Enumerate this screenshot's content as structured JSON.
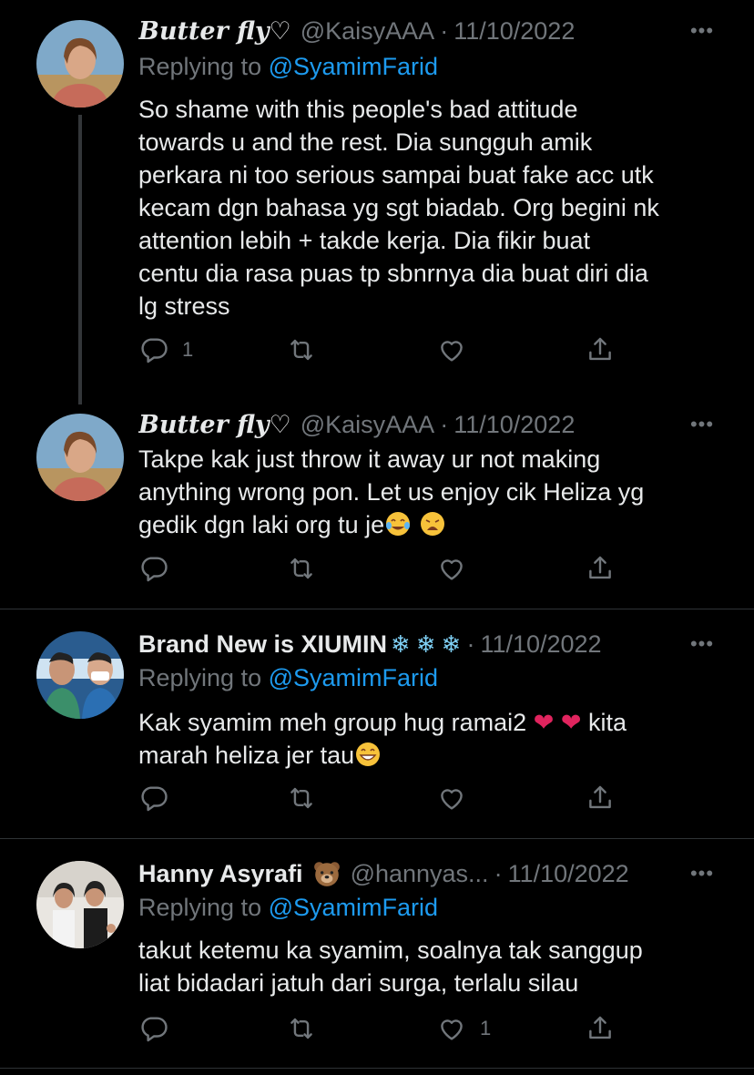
{
  "tweets": [
    {
      "name": "Butter fly♡",
      "handle": "@KaisyAAA",
      "date": "11/10/2022",
      "replying_prefix": "Replying to",
      "replying_to": "@SyamimFarid",
      "lines": [
        "So shame with this people's bad attitude",
        "towards u and the rest. Dia sungguh amik",
        "perkara ni too serious sampai buat fake acc utk",
        "kecam dgn bahasa yg sgt biadab. Org begini nk",
        "attention lebih + takde kerja. Dia fikir buat",
        "centu dia rasa puas tp sbnrnya dia buat diri dia",
        "lg stress"
      ],
      "reply_count": "1",
      "like_count": ""
    },
    {
      "name": "Butter fly♡",
      "handle": "@KaisyAAA",
      "date": "11/10/2022",
      "lines": [
        "Takpe kak just throw it away ur not making",
        "anything wrong pon. Let us enjoy cik Heliza yg",
        "gedik dgn laki org tu je"
      ],
      "reply_count": "",
      "like_count": ""
    },
    {
      "name": "Brand New is XIUMIN",
      "handle": "",
      "date": "11/10/2022",
      "replying_prefix": "Replying to",
      "replying_to": "@SyamimFarid",
      "lines": [
        "Kak syamim meh group hug ramai2",
        "marah heliza jer tau"
      ],
      "line1_suffix": "kita",
      "reply_count": "",
      "like_count": ""
    },
    {
      "name": "Hanny Asyrafi",
      "handle": "@hannyas...",
      "date": "11/10/2022",
      "replying_prefix": "Replying to",
      "replying_to": "@SyamimFarid",
      "lines": [
        "takut ketemu ka syamim, soalnya tak sanggup",
        "liat bidadari jatuh dari surga, terlalu silau"
      ],
      "reply_count": "",
      "like_count": "1"
    }
  ],
  "colors": {
    "background": "#000000",
    "text": "#e7e9ea",
    "muted": "#71767b",
    "mention": "#1d9bf0",
    "divider": "#2f3336"
  },
  "icons": [
    "reply-icon",
    "retweet-icon",
    "like-icon",
    "share-icon",
    "more-icon"
  ]
}
